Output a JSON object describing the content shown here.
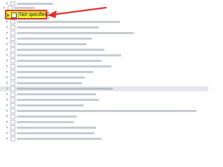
{
  "tree": {
    "focused_item": {
      "label": "Not specified",
      "checked": false,
      "highlight_color": "#f3f32e",
      "border_color": "#e4312b"
    }
  },
  "annotation": {
    "arrow_color": "#e4312b",
    "arrow_target": "focused-item"
  }
}
